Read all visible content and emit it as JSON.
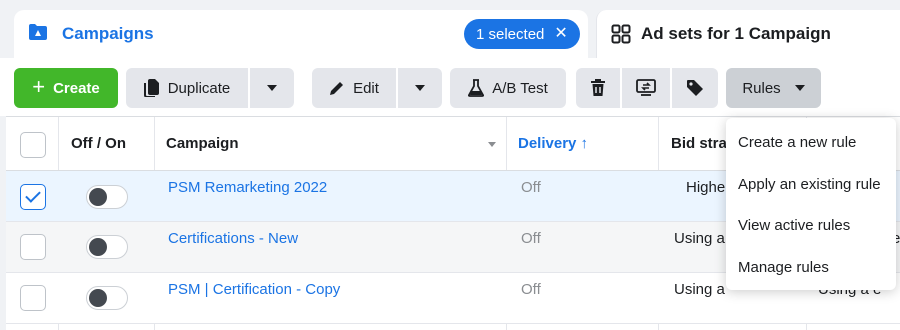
{
  "tabs": {
    "campaigns": {
      "label": "Campaigns",
      "icon": "folder-icon",
      "selected_badge": "1 selected"
    },
    "adsets": {
      "label": "Ad sets for 1 Campaign",
      "icon": "grid-icon"
    }
  },
  "toolbar": {
    "create_label": "Create",
    "duplicate_label": "Duplicate",
    "edit_label": "Edit",
    "ab_test_label": "A/B Test",
    "rules_label": "Rules"
  },
  "table": {
    "headers": {
      "toggle": "Off / On",
      "campaign": "Campaign",
      "delivery": "Delivery ↑",
      "bid": "Bid stra"
    },
    "rows": [
      {
        "name": "PSM Remarketing 2022",
        "delivery": "Off",
        "bid": "Highe",
        "bid2": "",
        "checked": true
      },
      {
        "name": "Certifications - New",
        "delivery": "Off",
        "bid": "Using a",
        "bid2": "e",
        "checked": false
      },
      {
        "name": "PSM | Certification - Copy",
        "delivery": "Off",
        "bid": "Using a",
        "bid2": "Using a e",
        "checked": false
      }
    ]
  },
  "rules_menu": {
    "items": [
      "Create a new rule",
      "Apply an existing rule",
      "View active rules",
      "Manage rules"
    ]
  },
  "colors": {
    "brand_blue": "#1b74e4",
    "create_green": "#42b72a"
  }
}
